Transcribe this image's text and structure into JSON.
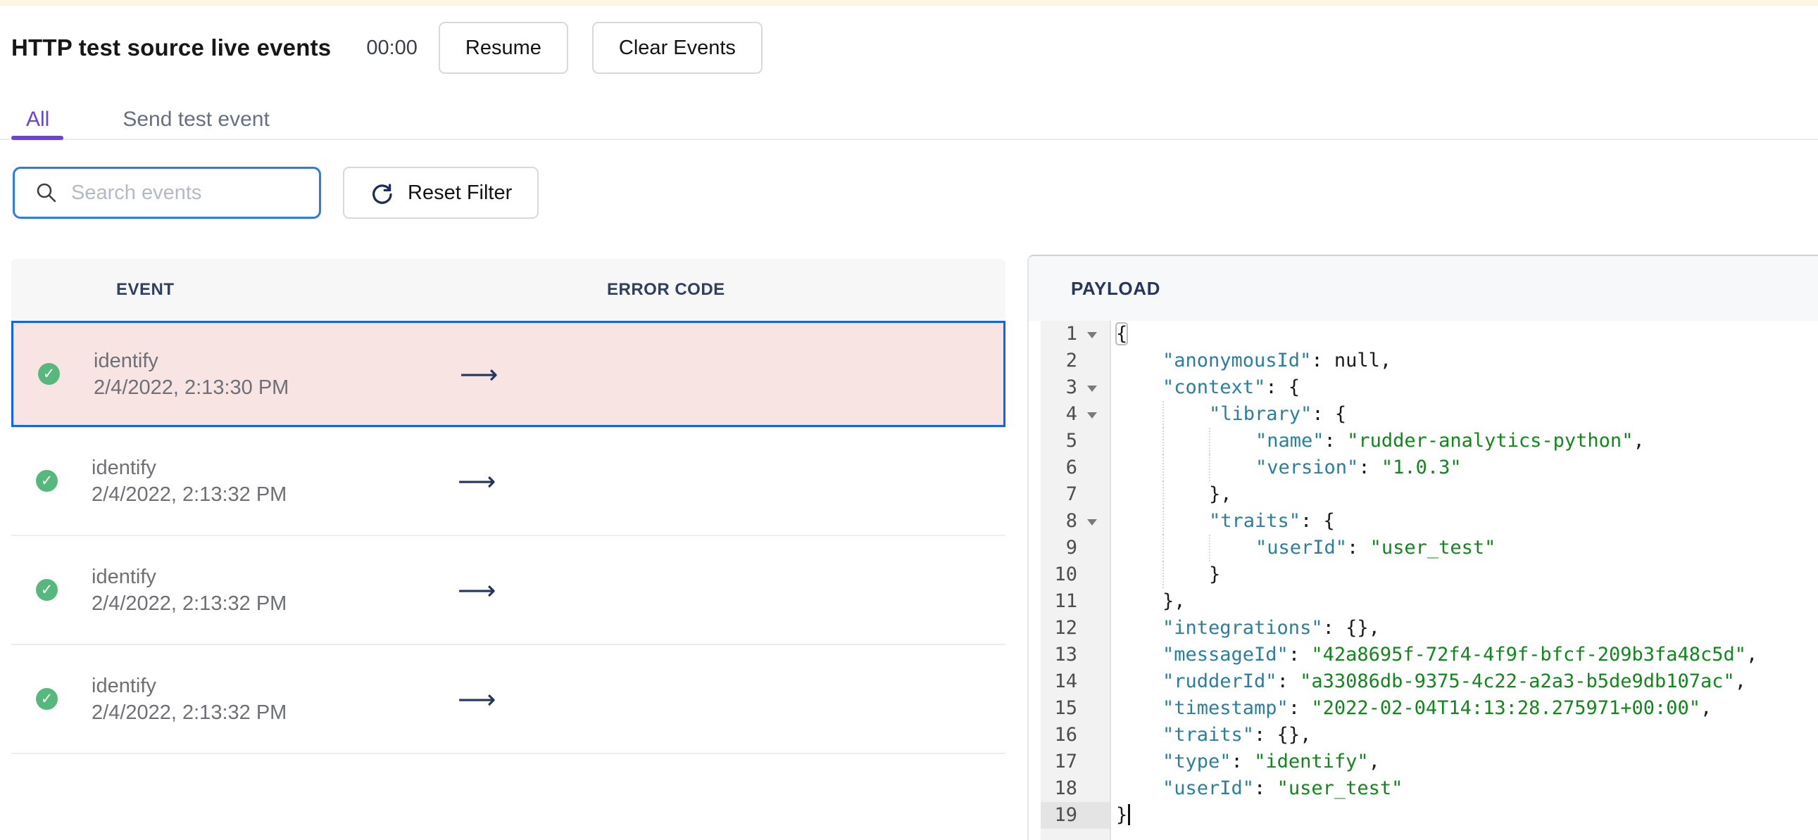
{
  "header": {
    "title": "HTTP test source live events",
    "timer": "00:00",
    "resume_label": "Resume",
    "clear_label": "Clear Events"
  },
  "tabs": {
    "all_label": "All",
    "send_label": "Send test event",
    "active": "All"
  },
  "filters": {
    "search_placeholder": "Search events",
    "reset_label": "Reset Filter"
  },
  "table": {
    "columns": [
      "EVENT",
      "ERROR CODE"
    ],
    "rows": [
      {
        "event": "identify",
        "timestamp": "2/4/2022, 2:13:30 PM",
        "status": "success",
        "error_code_arrow": "⟶",
        "selected": true
      },
      {
        "event": "identify",
        "timestamp": "2/4/2022, 2:13:32 PM",
        "status": "success",
        "error_code_arrow": "⟶",
        "selected": false
      },
      {
        "event": "identify",
        "timestamp": "2/4/2022, 2:13:32 PM",
        "status": "success",
        "error_code_arrow": "⟶",
        "selected": false
      },
      {
        "event": "identify",
        "timestamp": "2/4/2022, 2:13:32 PM",
        "status": "success",
        "error_code_arrow": "⟶",
        "selected": false
      }
    ]
  },
  "payload": {
    "title": "PAYLOAD",
    "lines": [
      {
        "n": 1,
        "indent": 0,
        "fold": true,
        "guides": [],
        "tokens": [
          {
            "c": "p",
            "t": "{",
            "box": true
          }
        ]
      },
      {
        "n": 2,
        "indent": 1,
        "fold": false,
        "guides": [],
        "tokens": [
          {
            "c": "k",
            "t": "\"anonymousId\""
          },
          {
            "c": "p",
            "t": ": "
          },
          {
            "c": "a",
            "t": "null"
          },
          {
            "c": "p",
            "t": ","
          }
        ]
      },
      {
        "n": 3,
        "indent": 1,
        "fold": true,
        "guides": [],
        "tokens": [
          {
            "c": "k",
            "t": "\"context\""
          },
          {
            "c": "p",
            "t": ": {"
          }
        ]
      },
      {
        "n": 4,
        "indent": 2,
        "fold": true,
        "guides": [
          1
        ],
        "tokens": [
          {
            "c": "k",
            "t": "\"library\""
          },
          {
            "c": "p",
            "t": ": {"
          }
        ]
      },
      {
        "n": 5,
        "indent": 3,
        "fold": false,
        "guides": [
          1,
          2
        ],
        "tokens": [
          {
            "c": "k",
            "t": "\"name\""
          },
          {
            "c": "p",
            "t": ": "
          },
          {
            "c": "s",
            "t": "\"rudder-analytics-python\""
          },
          {
            "c": "p",
            "t": ","
          }
        ]
      },
      {
        "n": 6,
        "indent": 3,
        "fold": false,
        "guides": [
          1,
          2
        ],
        "tokens": [
          {
            "c": "k",
            "t": "\"version\""
          },
          {
            "c": "p",
            "t": ": "
          },
          {
            "c": "s",
            "t": "\"1.0.3\""
          }
        ]
      },
      {
        "n": 7,
        "indent": 2,
        "fold": false,
        "guides": [
          1
        ],
        "tokens": [
          {
            "c": "p",
            "t": "},"
          }
        ]
      },
      {
        "n": 8,
        "indent": 2,
        "fold": true,
        "guides": [
          1
        ],
        "tokens": [
          {
            "c": "k",
            "t": "\"traits\""
          },
          {
            "c": "p",
            "t": ": {"
          }
        ]
      },
      {
        "n": 9,
        "indent": 3,
        "fold": false,
        "guides": [
          1,
          2
        ],
        "tokens": [
          {
            "c": "k",
            "t": "\"userId\""
          },
          {
            "c": "p",
            "t": ": "
          },
          {
            "c": "s",
            "t": "\"user_test\""
          }
        ]
      },
      {
        "n": 10,
        "indent": 2,
        "fold": false,
        "guides": [
          1
        ],
        "tokens": [
          {
            "c": "p",
            "t": "}"
          }
        ]
      },
      {
        "n": 11,
        "indent": 1,
        "fold": false,
        "guides": [],
        "tokens": [
          {
            "c": "p",
            "t": "},"
          }
        ]
      },
      {
        "n": 12,
        "indent": 1,
        "fold": false,
        "guides": [],
        "tokens": [
          {
            "c": "k",
            "t": "\"integrations\""
          },
          {
            "c": "p",
            "t": ": {},"
          }
        ]
      },
      {
        "n": 13,
        "indent": 1,
        "fold": false,
        "guides": [],
        "tokens": [
          {
            "c": "k",
            "t": "\"messageId\""
          },
          {
            "c": "p",
            "t": ": "
          },
          {
            "c": "s",
            "t": "\"42a8695f-72f4-4f9f-bfcf-209b3fa48c5d\""
          },
          {
            "c": "p",
            "t": ","
          }
        ]
      },
      {
        "n": 14,
        "indent": 1,
        "fold": false,
        "guides": [],
        "tokens": [
          {
            "c": "k",
            "t": "\"rudderId\""
          },
          {
            "c": "p",
            "t": ": "
          },
          {
            "c": "s",
            "t": "\"a33086db-9375-4c22-a2a3-b5de9db107ac\""
          },
          {
            "c": "p",
            "t": ","
          }
        ]
      },
      {
        "n": 15,
        "indent": 1,
        "fold": false,
        "guides": [],
        "tokens": [
          {
            "c": "k",
            "t": "\"timestamp\""
          },
          {
            "c": "p",
            "t": ": "
          },
          {
            "c": "s",
            "t": "\"2022-02-04T14:13:28.275971+00:00\""
          },
          {
            "c": "p",
            "t": ","
          }
        ]
      },
      {
        "n": 16,
        "indent": 1,
        "fold": false,
        "guides": [],
        "tokens": [
          {
            "c": "k",
            "t": "\"traits\""
          },
          {
            "c": "p",
            "t": ": {},"
          }
        ]
      },
      {
        "n": 17,
        "indent": 1,
        "fold": false,
        "guides": [],
        "tokens": [
          {
            "c": "k",
            "t": "\"type\""
          },
          {
            "c": "p",
            "t": ": "
          },
          {
            "c": "s",
            "t": "\"identify\""
          },
          {
            "c": "p",
            "t": ","
          }
        ]
      },
      {
        "n": 18,
        "indent": 1,
        "fold": false,
        "guides": [],
        "tokens": [
          {
            "c": "k",
            "t": "\"userId\""
          },
          {
            "c": "p",
            "t": ": "
          },
          {
            "c": "s",
            "t": "\"user_test\""
          }
        ]
      },
      {
        "n": 19,
        "indent": 0,
        "fold": false,
        "guides": [],
        "active": true,
        "cursor": true,
        "tokens": [
          {
            "c": "p",
            "t": "}"
          }
        ]
      }
    ]
  },
  "colors": {
    "accent_purple": "#6c40e4",
    "selected_border_blue": "#0d65ee",
    "selected_row_pink": "#f7e4e3",
    "success_green": "#57b87d",
    "heading_navy": "#31405e",
    "search_focus_blue": "#2f78ee",
    "code_key_teal": "#2b7f9c",
    "code_string_green": "#12861d",
    "top_strip_cream": "#fcf5e0"
  }
}
